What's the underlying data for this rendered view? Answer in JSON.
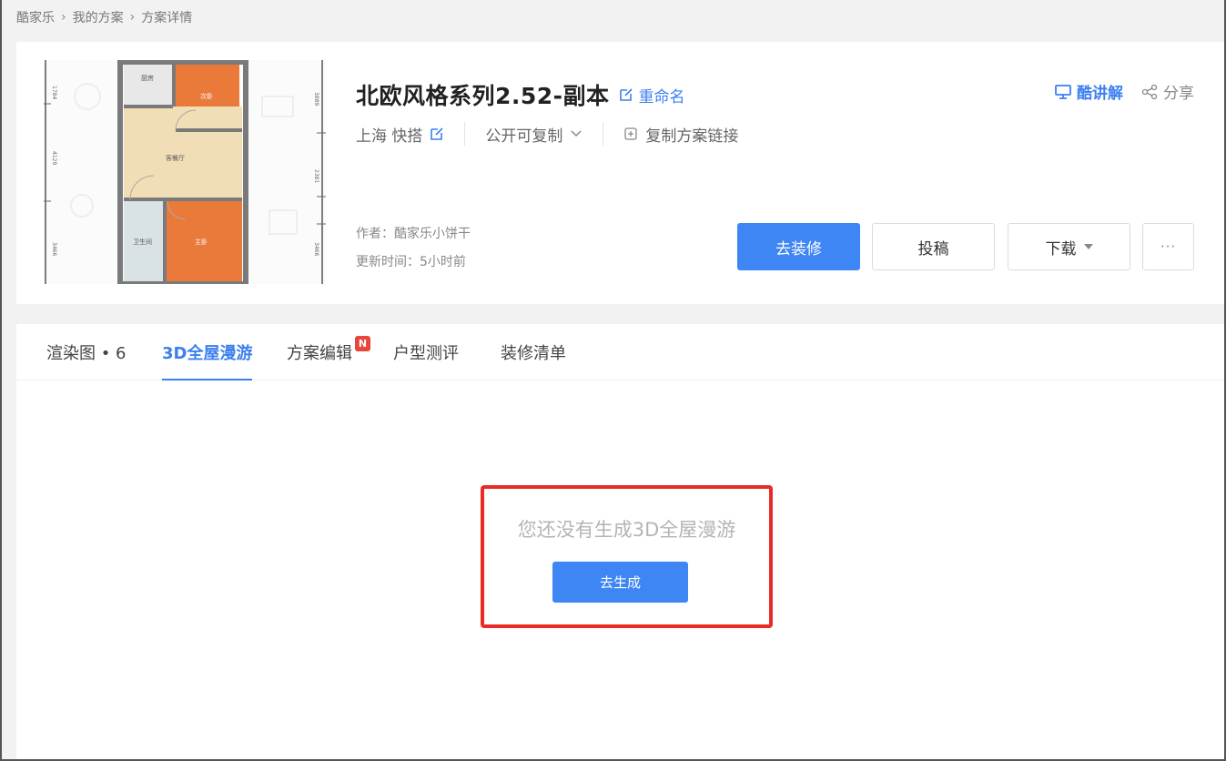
{
  "breadcrumb": {
    "home": "酷家乐",
    "my_plans": "我的方案",
    "current": "方案详情"
  },
  "plan": {
    "title": "北欧风格系列2.52-副本",
    "rename_label": "重命名",
    "location": "上海 快搭",
    "visibility": "公开可复制",
    "copy_link_label": "复制方案链接",
    "author": "作者：酷家乐小饼干",
    "updated": "更新时间：5小时前"
  },
  "floorplan": {
    "rooms": [
      "厨房",
      "次卧",
      "客餐厅",
      "卫生间",
      "主卧"
    ],
    "dims_left": [
      "1784",
      "4129",
      "3466"
    ],
    "dims_right": [
      "3889",
      "2381",
      "3466"
    ]
  },
  "top_actions": {
    "lecture": "酷讲解",
    "share": "分享"
  },
  "buttons": {
    "renovate": "去装修",
    "submit": "投稿",
    "download": "下载",
    "more": "···"
  },
  "tabs": {
    "render": "渲染图 • 6",
    "tour3d": "3D全屋漫游",
    "edit": "方案编辑",
    "edit_badge": "N",
    "layout": "户型测评",
    "list": "装修清单"
  },
  "empty_state": {
    "message": "您还没有生成3D全屋漫游",
    "generate": "去生成"
  },
  "colors": {
    "accent": "#3f86f5",
    "highlight_border": "#ea2a25",
    "badge": "#e8463a"
  }
}
